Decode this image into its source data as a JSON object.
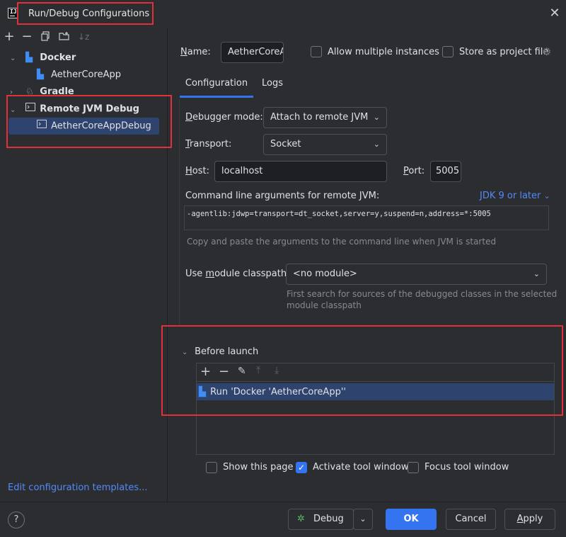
{
  "window": {
    "title": "Run/Debug Configurations",
    "app_icon": "IJ"
  },
  "left_toolbar": {
    "icons": [
      "add-icon",
      "remove-icon",
      "copy-icon",
      "folder-icon",
      "sort-icon"
    ]
  },
  "tree": {
    "docker_label": "Docker",
    "docker_child": "AetherCoreApp",
    "gradle_label": "Gradle",
    "remote_label": "Remote JVM Debug",
    "remote_child": "AetherCoreAppDebug"
  },
  "edit_templates_link": "Edit configuration templates...",
  "name_field": {
    "label": "Name:",
    "value": "AetherCoreA"
  },
  "allow_multiple": {
    "label": "Allow multiple instances",
    "checked": false
  },
  "store_project": {
    "label": "Store as project file",
    "checked": false
  },
  "tabs": [
    {
      "label": "Configuration"
    },
    {
      "label": "Logs"
    }
  ],
  "debugger_mode": {
    "label": "Debugger mode:",
    "value": "Attach to remote JVM"
  },
  "transport": {
    "label": "Transport:",
    "value": "Socket"
  },
  "host": {
    "label": "Host:",
    "value": "localhost"
  },
  "port": {
    "label": "Port:",
    "value": "5005"
  },
  "cmd_args": {
    "label": "Command line arguments for remote JVM:",
    "jdk_link": "JDK 9 or later",
    "value": "-agentlib:jdwp=transport=dt_socket,server=y,suspend=n,address=*:5005",
    "hint": "Copy and paste the arguments to the command line when JVM is started"
  },
  "module_classpath": {
    "label": "Use module classpath:",
    "value": "<no module>",
    "hint_line1": "First search for sources of the debugged classes in the selected",
    "hint_line2": "module classpath"
  },
  "before_launch": {
    "label": "Before launch",
    "items": [
      "Run 'Docker 'AetherCoreApp''"
    ]
  },
  "options": {
    "show_page": {
      "label": "Show this page",
      "checked": false
    },
    "activate_tool": {
      "label": "Activate tool window",
      "checked": true
    },
    "focus_tool": {
      "label": "Focus tool window",
      "checked": false
    }
  },
  "footer": {
    "help": "?",
    "debug_button": "Debug",
    "ok_button": "OK",
    "cancel_button": "Cancel",
    "apply_button": "Apply"
  },
  "colors": {
    "accent": "#3574f0",
    "highlight_box": "#e0303b",
    "selection": "#2e436e",
    "background": "#2b2d30"
  }
}
